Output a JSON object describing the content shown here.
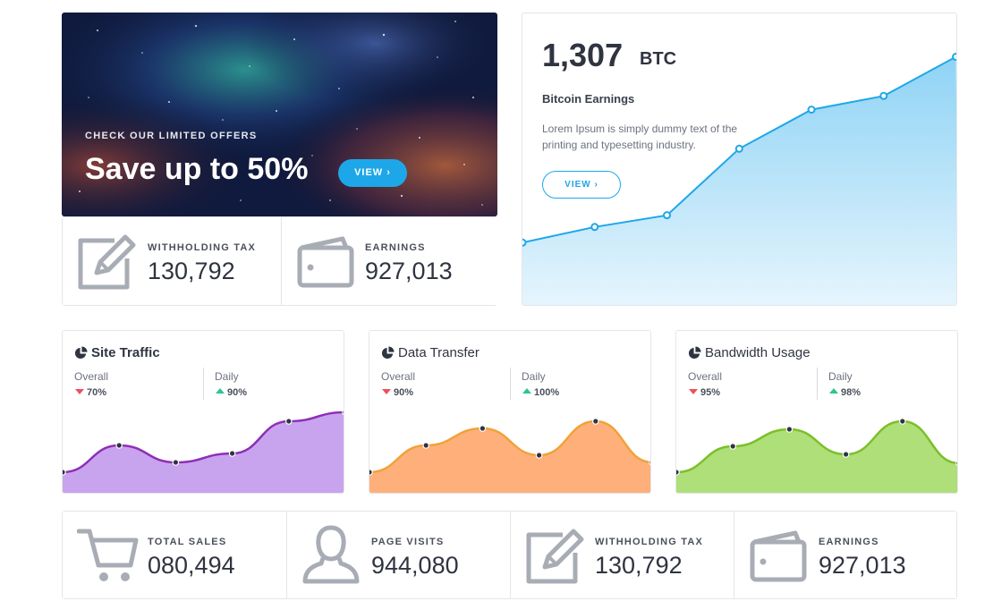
{
  "hero": {
    "kicker": "CHECK OUR LIMITED OFFERS",
    "title": "Save up to 50%",
    "button": "VIEW ›"
  },
  "top_stats": [
    {
      "label": "WITHHOLDING TAX",
      "value": "130,792",
      "icon": "edit-icon"
    },
    {
      "label": "EARNINGS",
      "value": "927,013",
      "icon": "wallet-icon"
    }
  ],
  "bitcoin": {
    "amount": "1,307",
    "unit": "BTC",
    "title": "Bitcoin Earnings",
    "description": "Lorem Ipsum is simply dummy text of the printing and typesetting industry.",
    "button": "VIEW ›",
    "accent": "#1ea7e8"
  },
  "chart_data": [
    {
      "type": "area",
      "title": "",
      "x": [
        0,
        1,
        2,
        3,
        4,
        5,
        6
      ],
      "y": [
        20,
        28,
        34,
        68,
        88,
        95,
        115
      ]
    },
    {
      "type": "area",
      "title": "Site Traffic",
      "x": [
        0,
        1,
        2,
        3,
        4,
        5
      ],
      "y": [
        25,
        55,
        36,
        46,
        82,
        92
      ],
      "color": "#8e2fb5",
      "fill": "#c8a4ee"
    },
    {
      "type": "area",
      "title": "Data Transfer",
      "x": [
        0,
        1,
        2,
        3,
        4,
        5
      ],
      "y": [
        25,
        55,
        74,
        44,
        82,
        36
      ],
      "color": "#f0a23a",
      "fill": "#ffb07a"
    },
    {
      "type": "area",
      "title": "Bandwidth Usage",
      "x": [
        0,
        1,
        2,
        3,
        4,
        5
      ],
      "y": [
        25,
        54,
        73,
        45,
        82,
        35
      ],
      "color": "#7cbf2a",
      "fill": "#aedf78"
    }
  ],
  "mini_cards": [
    {
      "title": "Site Traffic",
      "overall_label": "Overall",
      "overall": "70%",
      "daily_label": "Daily",
      "daily": "90%"
    },
    {
      "title": "Data Transfer",
      "overall_label": "Overall",
      "overall": "90%",
      "daily_label": "Daily",
      "daily": "100%"
    },
    {
      "title": "Bandwidth Usage",
      "overall_label": "Overall",
      "overall": "95%",
      "daily_label": "Daily",
      "daily": "98%"
    }
  ],
  "bottom_stats": [
    {
      "label": "TOTAL SALES",
      "value": "080,494",
      "icon": "cart-icon"
    },
    {
      "label": "PAGE VISITS",
      "value": "944,080",
      "icon": "user-icon"
    },
    {
      "label": "WITHHOLDING TAX",
      "value": "130,792",
      "icon": "edit-icon"
    },
    {
      "label": "EARNINGS",
      "value": "927,013",
      "icon": "wallet-icon"
    }
  ]
}
